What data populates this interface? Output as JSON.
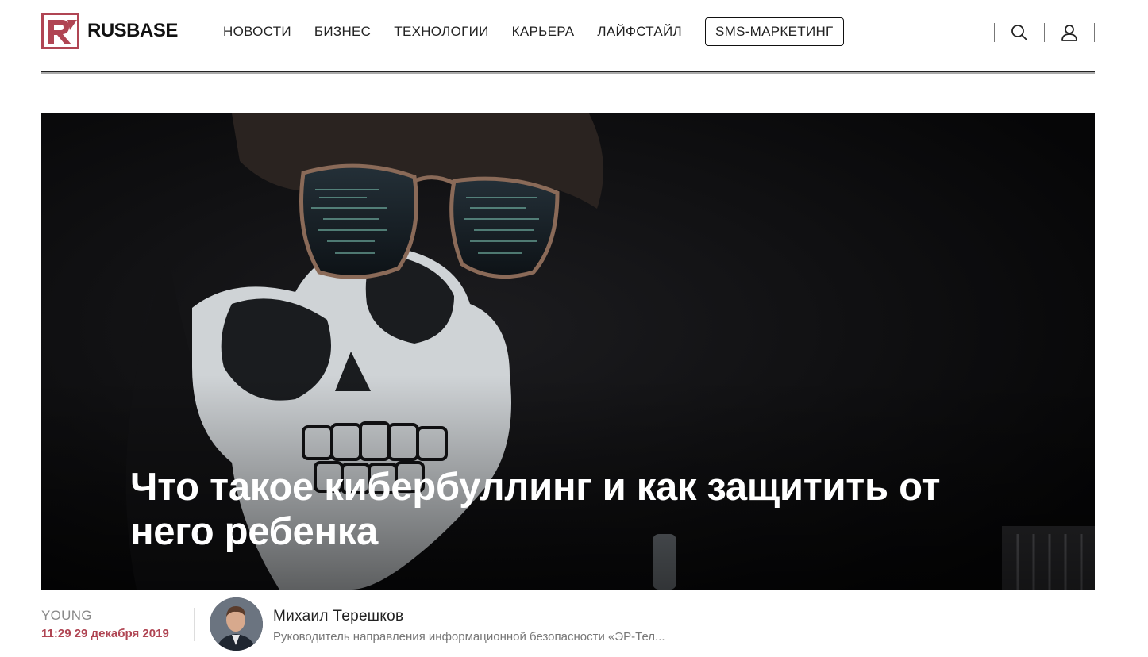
{
  "brand": {
    "name": "RUSBASE",
    "color": "#b04553"
  },
  "nav": {
    "items": [
      {
        "label": "НОВОСТИ"
      },
      {
        "label": "БИЗНЕС"
      },
      {
        "label": "ТЕХНОЛОГИИ"
      },
      {
        "label": "КАРЬЕРА"
      },
      {
        "label": "ЛАЙФСТАЙЛ"
      }
    ],
    "highlight": {
      "label": "SMS-МАРКЕТИНГ"
    }
  },
  "header_icons": [
    "search-icon",
    "user-icon"
  ],
  "article": {
    "title": "Что такое кибербуллинг и как защитить от него ребенка",
    "category": "YOUNG",
    "datetime": "11:29 29 декабря 2019",
    "author": {
      "name": "Михаил Терешков",
      "role": "Руководитель направления информационной безопасности «ЭР-Тел..."
    }
  }
}
